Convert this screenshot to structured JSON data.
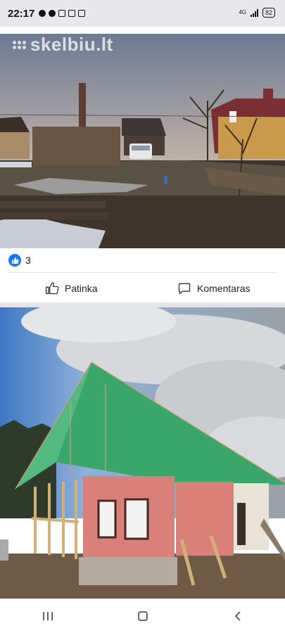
{
  "status_bar": {
    "time": "22:17",
    "network": "4G",
    "battery": "82",
    "icons": [
      "whatsapp-icon",
      "alarm-icon",
      "nfc-icon",
      "app-notification-icon",
      "lock-icon",
      "signal-icon",
      "battery-icon"
    ]
  },
  "post": {
    "watermark": "skelbiu.lt",
    "reaction_count": "3",
    "like_label": "Patinka",
    "comment_label": "Komentaras"
  },
  "nav": {
    "icons": [
      "recent-apps-icon",
      "home-icon",
      "back-icon"
    ]
  },
  "colors": {
    "facebook_blue": "#1877f2",
    "roof_green": "#3aa66a",
    "wall_pink": "#d88079"
  }
}
